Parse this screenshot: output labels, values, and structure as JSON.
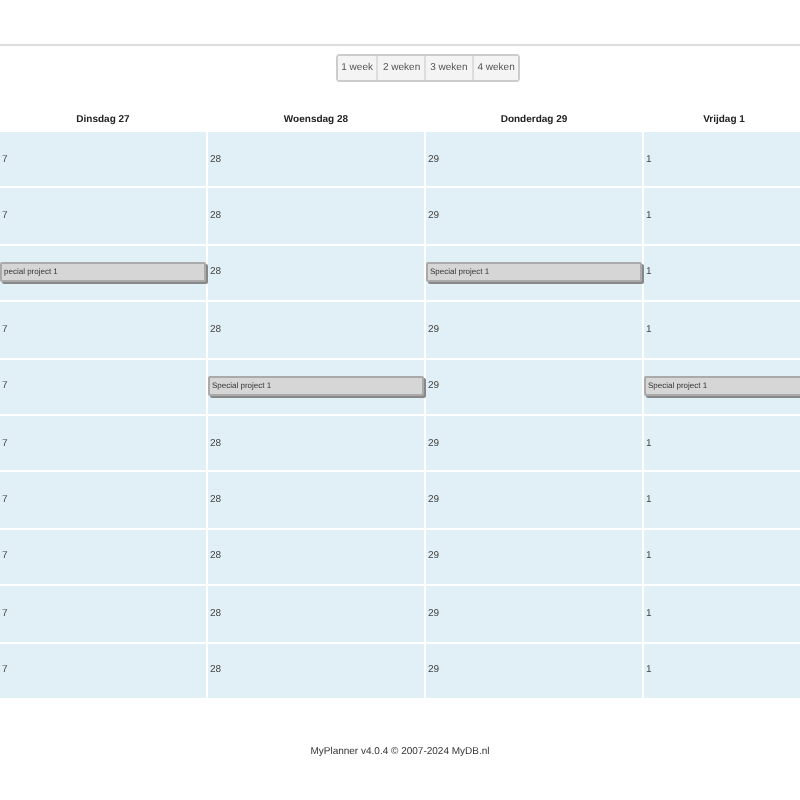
{
  "range_buttons": [
    {
      "label": "1 week",
      "selected": false
    },
    {
      "label": "2 weken",
      "selected": false
    },
    {
      "label": "3 weken",
      "selected": false
    },
    {
      "label": "4 weken",
      "selected": false
    }
  ],
  "columns": [
    "Dinsdag 27",
    "Woensdag 28",
    "Donderdag 29",
    "Vrijdag 1"
  ],
  "rows": [
    [
      {
        "kind": "date",
        "text": "7"
      },
      {
        "kind": "date",
        "text": "28"
      },
      {
        "kind": "date",
        "text": "29"
      },
      {
        "kind": "date",
        "text": "1"
      }
    ],
    [
      {
        "kind": "date",
        "text": "7"
      },
      {
        "kind": "date",
        "text": "28"
      },
      {
        "kind": "date",
        "text": "29"
      },
      {
        "kind": "date",
        "text": "1"
      }
    ],
    [
      {
        "kind": "event",
        "text": "pecial project 1"
      },
      {
        "kind": "date",
        "text": "28"
      },
      {
        "kind": "event",
        "text": "Special project 1"
      },
      {
        "kind": "date",
        "text": "1"
      }
    ],
    [
      {
        "kind": "date",
        "text": "7"
      },
      {
        "kind": "date",
        "text": "28"
      },
      {
        "kind": "date",
        "text": "29"
      },
      {
        "kind": "date",
        "text": "1"
      }
    ],
    [
      {
        "kind": "date",
        "text": "7"
      },
      {
        "kind": "event",
        "text": "Special project 1"
      },
      {
        "kind": "date",
        "text": "29"
      },
      {
        "kind": "event",
        "text": "Special project 1"
      }
    ],
    [
      {
        "kind": "date",
        "text": "7"
      },
      {
        "kind": "date",
        "text": "28"
      },
      {
        "kind": "date",
        "text": "29"
      },
      {
        "kind": "date",
        "text": "1"
      }
    ],
    [
      {
        "kind": "date",
        "text": "7"
      },
      {
        "kind": "date",
        "text": "28"
      },
      {
        "kind": "date",
        "text": "29"
      },
      {
        "kind": "date",
        "text": "1"
      }
    ],
    [
      {
        "kind": "date",
        "text": "7"
      },
      {
        "kind": "date",
        "text": "28"
      },
      {
        "kind": "date",
        "text": "29"
      },
      {
        "kind": "date",
        "text": "1"
      }
    ],
    [
      {
        "kind": "date",
        "text": "7"
      },
      {
        "kind": "date",
        "text": "28"
      },
      {
        "kind": "date",
        "text": "29"
      },
      {
        "kind": "date",
        "text": "1"
      }
    ],
    [
      {
        "kind": "date",
        "text": "7"
      },
      {
        "kind": "date",
        "text": "28"
      },
      {
        "kind": "date",
        "text": "29"
      },
      {
        "kind": "date",
        "text": "1"
      }
    ]
  ],
  "footer": "MyPlanner v4.0.4 © 2007-2024 MyDB.nl"
}
